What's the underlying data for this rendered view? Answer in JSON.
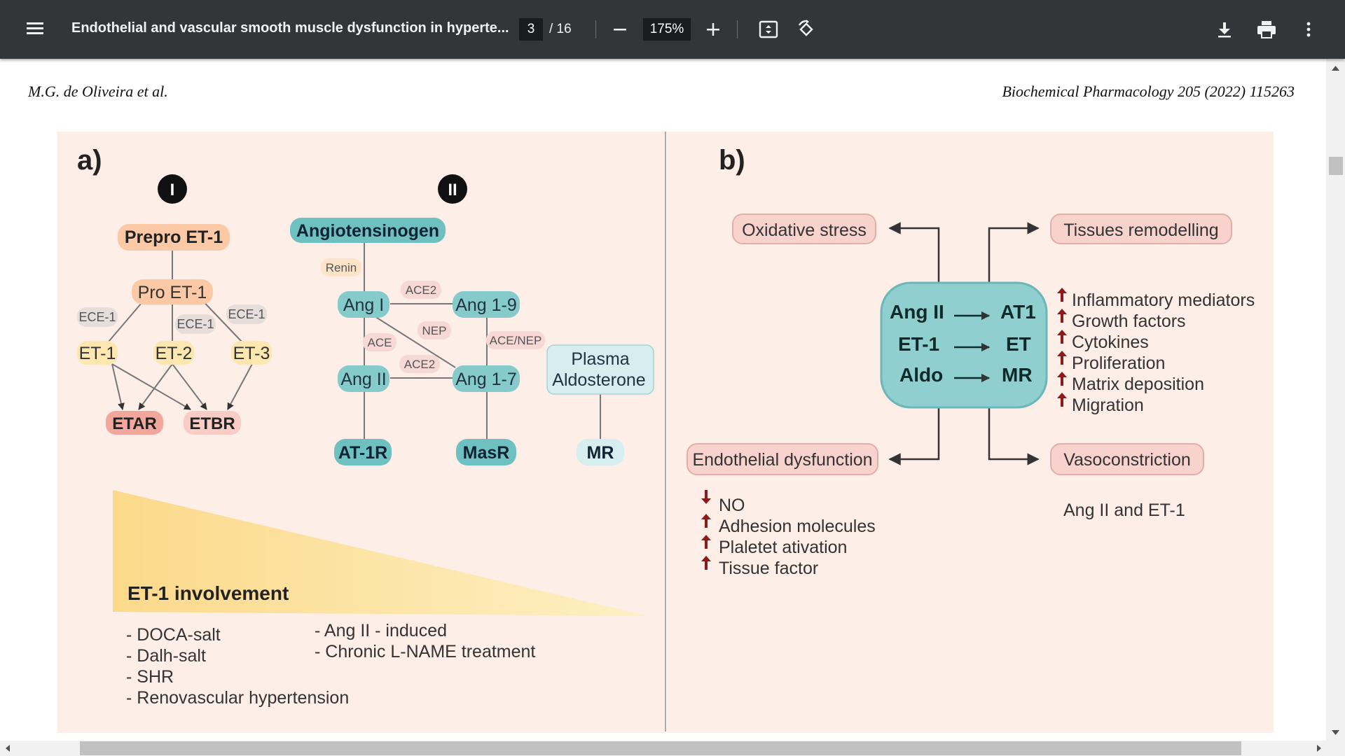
{
  "toolbar": {
    "title": "Endothelial and vascular smooth muscle dysfunction in hyperte...",
    "page_current": "3",
    "page_total": "/ 16",
    "zoom": "175%"
  },
  "page": {
    "header_left": "M.G. de Oliveira et al.",
    "header_right": "Biochemical Pharmacology 205 (2022) 115263"
  },
  "figure": {
    "panel_a": {
      "label": "a)",
      "marker_1": "I",
      "marker_2": "II",
      "prepro": "Prepro ET-1",
      "pro": "Pro ET-1",
      "ece": "ECE-1",
      "et1": "ET-1",
      "et2": "ET-2",
      "et3": "ET-3",
      "etar": "ETAR",
      "etbr": "ETBR",
      "angiotensinogen": "Angiotensinogen",
      "renin": "Renin",
      "ang1": "Ang I",
      "ang19": "Ang 1-9",
      "ang2": "Ang II",
      "ang17": "Ang 1-7",
      "ace2_a": "ACE2",
      "ace": "ACE",
      "nep": "NEP",
      "ace_nep": "ACE/NEP",
      "ace2_b": "ACE2",
      "plasma": "Plasma",
      "aldosterone": "Aldosterone",
      "at1r": "AT-1R",
      "masr": "MasR",
      "mr": "MR",
      "involvement": "ET-1 involvement",
      "list_left": [
        "- DOCA-salt",
        "- Dalh-salt",
        "- SHR",
        "- Renovascular hypertension"
      ],
      "list_right": [
        "- Ang II - induced",
        "- Chronic L-NAME treatment"
      ]
    },
    "panel_b": {
      "label": "b)",
      "oxidative": "Oxidative stress",
      "remodelling": "Tissues remodelling",
      "endothelial": "Endothelial dysfunction",
      "vasoconstriction": "Vasoconstriction",
      "row1_left": "Ang II",
      "row1_right": "AT1",
      "row2_left": "ET-1",
      "row2_right": "ET",
      "row3_left": "Aldo",
      "row3_right": "MR",
      "effects": [
        "Inflammatory mediators",
        "Growth factors",
        "Cytokines",
        "Proliferation",
        "Matrix deposition",
        "Migration"
      ],
      "endo_effects": [
        "NO",
        "Adhesion molecules",
        "Plaletet ativation",
        "Tissue factor"
      ],
      "vaso_note": "Ang II and ET-1"
    }
  },
  "colors": {
    "toolbar_bg": "#323639",
    "panel_bg": "#fdeee8",
    "orange_box": "#fbd3b1",
    "teal_box": "#7fc6c8",
    "red_arrow": "#8b1a1a"
  }
}
